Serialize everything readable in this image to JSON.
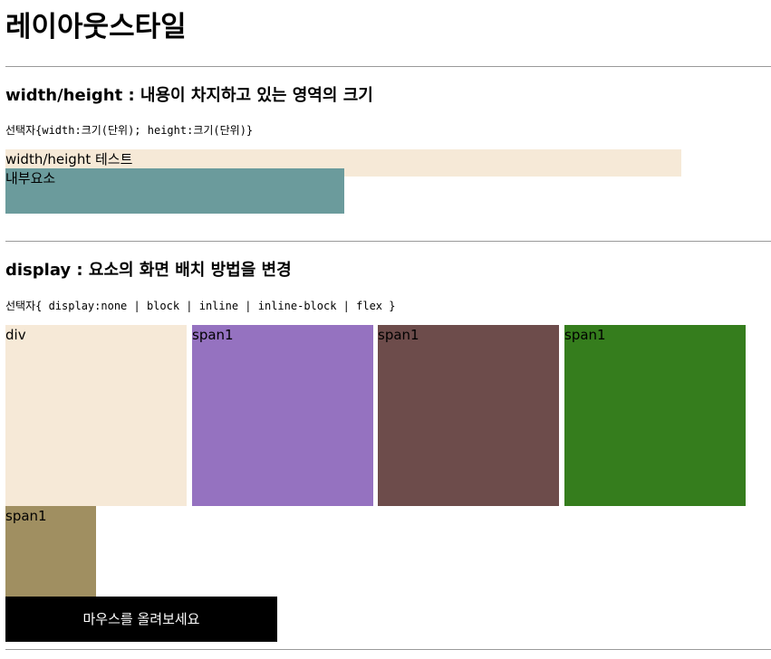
{
  "page_title": "레이아웃스타일",
  "sections": [
    {
      "title": "width/height : 내용이 차지하고 있는 영역의 크기",
      "syntax": "선택자{width:크기(단위); height:크기(단위)}",
      "outer_box_text": "width/height 테스트",
      "inner_box_text": "내부요소",
      "colors": {
        "outer": "#f6e9d7",
        "inner": "#6b9b9c"
      }
    },
    {
      "title": "display : 요소의 화면 배치 방법을 변경",
      "syntax": "선택자{ display:none | block | inline | inline-block | flex }",
      "boxes": [
        {
          "label": "div",
          "color": "#f6e9d7"
        },
        {
          "label": "span1",
          "color": "#9572c0"
        },
        {
          "label": "span1",
          "color": "#6d4c4b"
        },
        {
          "label": "span1",
          "color": "#357d1d"
        },
        {
          "label": "span1",
          "color": "#a08f61"
        }
      ],
      "hover_button": "마우스를 올려보세요"
    }
  ]
}
